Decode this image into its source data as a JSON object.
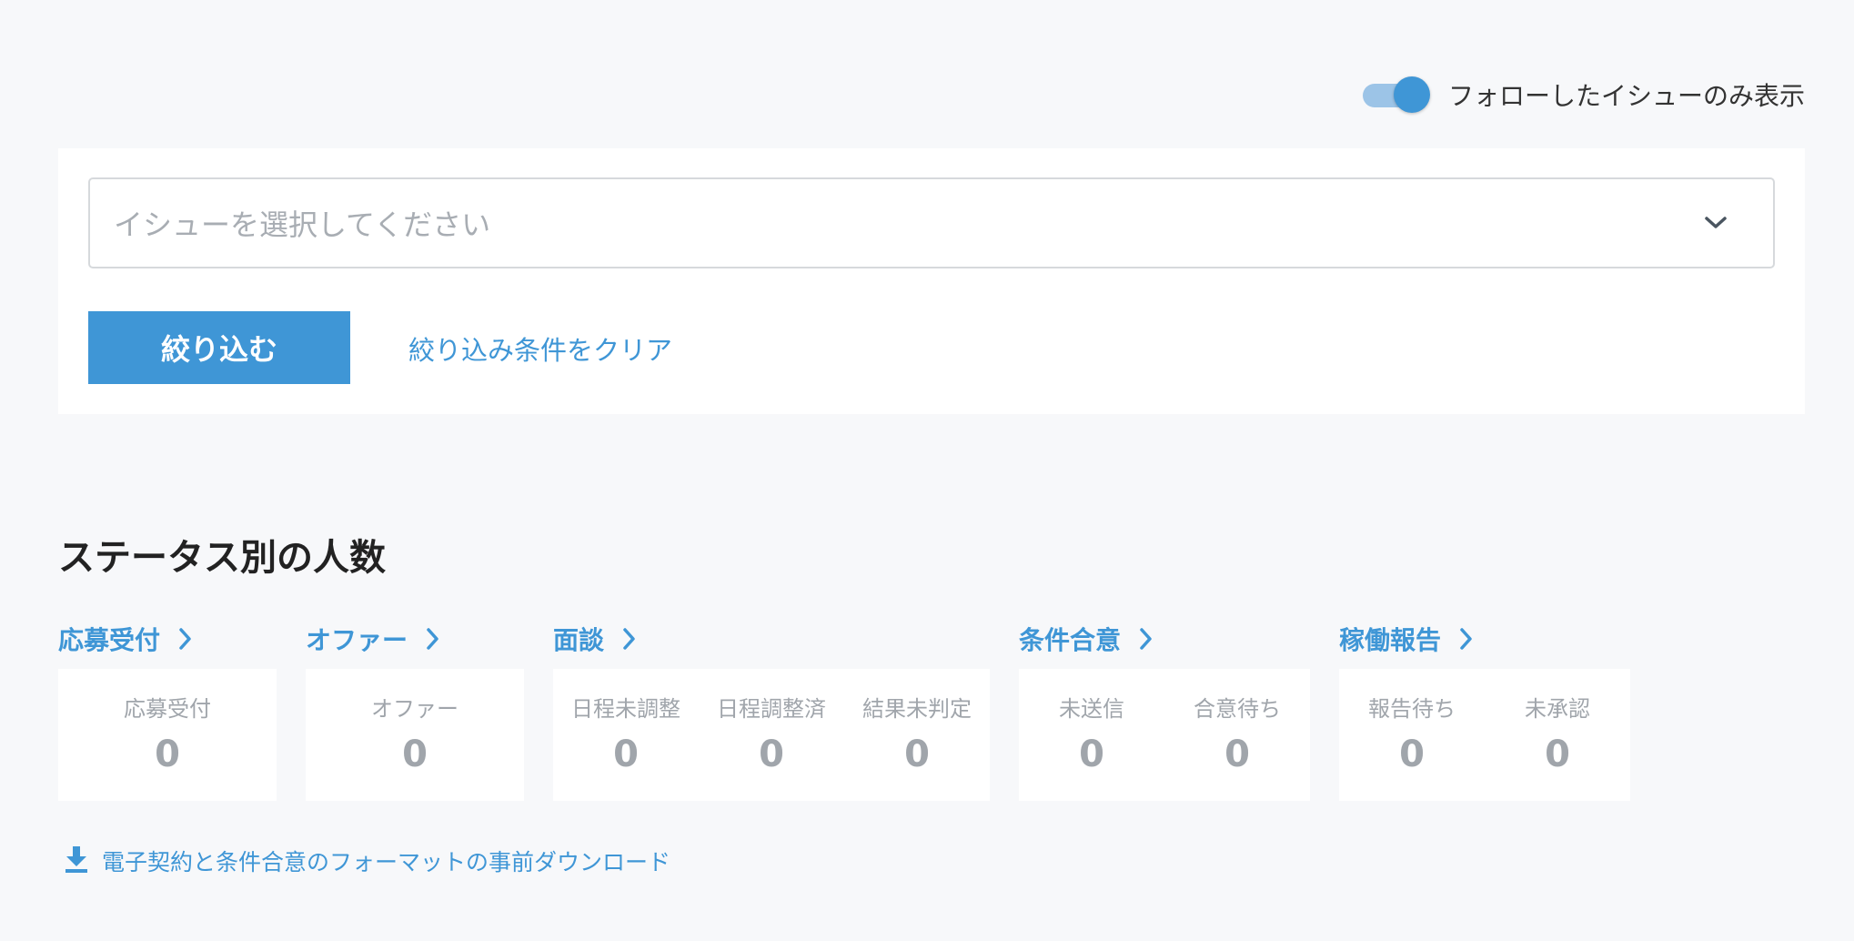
{
  "toggle": {
    "label": "フォローしたイシューのみ表示",
    "on": true
  },
  "filter": {
    "issue_placeholder": "イシューを選択してください",
    "filter_button": "絞り込む",
    "clear_link": "絞り込み条件をクリア"
  },
  "status": {
    "title": "ステータス別の人数",
    "groups": [
      {
        "title": "応募受付",
        "cells": [
          {
            "label": "応募受付",
            "value": "0"
          }
        ]
      },
      {
        "title": "オファー",
        "cells": [
          {
            "label": "オファー",
            "value": "0"
          }
        ]
      },
      {
        "title": "面談",
        "cells": [
          {
            "label": "日程未調整",
            "value": "0"
          },
          {
            "label": "日程調整済",
            "value": "0"
          },
          {
            "label": "結果未判定",
            "value": "0"
          }
        ]
      },
      {
        "title": "条件合意",
        "cells": [
          {
            "label": "未送信",
            "value": "0"
          },
          {
            "label": "合意待ち",
            "value": "0"
          }
        ]
      },
      {
        "title": "稼働報告",
        "cells": [
          {
            "label": "報告待ち",
            "value": "0"
          },
          {
            "label": "未承認",
            "value": "0"
          }
        ]
      }
    ]
  },
  "download_link": "電子契約と条件合意のフォーマットの事前ダウンロード",
  "colors": {
    "accent": "#3f96d6",
    "muted": "#a0a5ab",
    "background": "#f7f8fa"
  }
}
